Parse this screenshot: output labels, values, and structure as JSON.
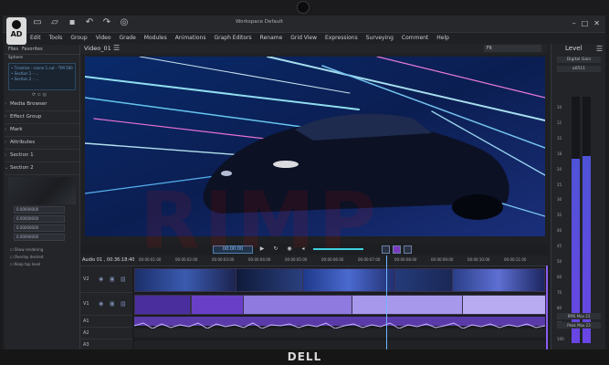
{
  "window": {
    "title": "Workspace Default"
  },
  "logo": {
    "text": "AD"
  },
  "menu": [
    "Edit",
    "Tools",
    "Group",
    "Video",
    "Grade",
    "Modules",
    "Animations",
    "Graph Editors",
    "Rename",
    "Grid View",
    "Expressions",
    "Surveying",
    "Comment",
    "Help"
  ],
  "left_panel": {
    "tabs": [
      "Files",
      "Favorites"
    ],
    "tree_header": "Sphere",
    "tree_lines": [
      "• Timeline - scene 1.cut   -   TIM 560",
      "• Section 1 - ...",
      "• Section 2 - ...",
      "• Audio - track 1"
    ],
    "sections": [
      "Media Browser",
      "Effect Group",
      "Mark",
      "Attributes",
      "Section 1",
      "Section 2"
    ],
    "fields": [
      "0.00000000",
      "0.00000000",
      "0.00000000",
      "0.00000000"
    ],
    "checks": [
      "Show rendering",
      "Overlay desired",
      "Keep top level"
    ]
  },
  "viewer": {
    "title": "Video_01",
    "fit": "Fit"
  },
  "timeline": {
    "timecode": "Audio 01 , 00:36:18:40",
    "ruler": [
      "00:00:01:00",
      "00:00:02:00",
      "00:00:03:00",
      "00:00:04:00",
      "00:00:05:00",
      "00:00:06:00",
      "00:00:07:00",
      "00:00:08:00",
      "00:00:09:00",
      "00:00:10:00",
      "00:00:11:00"
    ],
    "tracks": [
      "V2",
      "V1",
      "A1",
      "A2",
      "A3"
    ]
  },
  "transport": {
    "timecode": "00:00:00"
  },
  "meter": {
    "title": "Level",
    "top_label": "Digital Gain",
    "value_label": "a0511",
    "scale": [
      "10",
      "12",
      "15",
      "18",
      "20",
      "25",
      "30",
      "35",
      "40",
      "45",
      "50",
      "60",
      "70",
      "80",
      "90",
      "100"
    ],
    "bottom_labels": [
      "RMS Max 23",
      "Peak Max 23"
    ],
    "left_level": 0.75,
    "right_level": 0.76
  },
  "colors": {
    "accent": "#4f7fb0",
    "meter": "#5a4ce0",
    "clip": "#7a5cd8"
  },
  "watermark": "RIMP",
  "brand": "DELL"
}
